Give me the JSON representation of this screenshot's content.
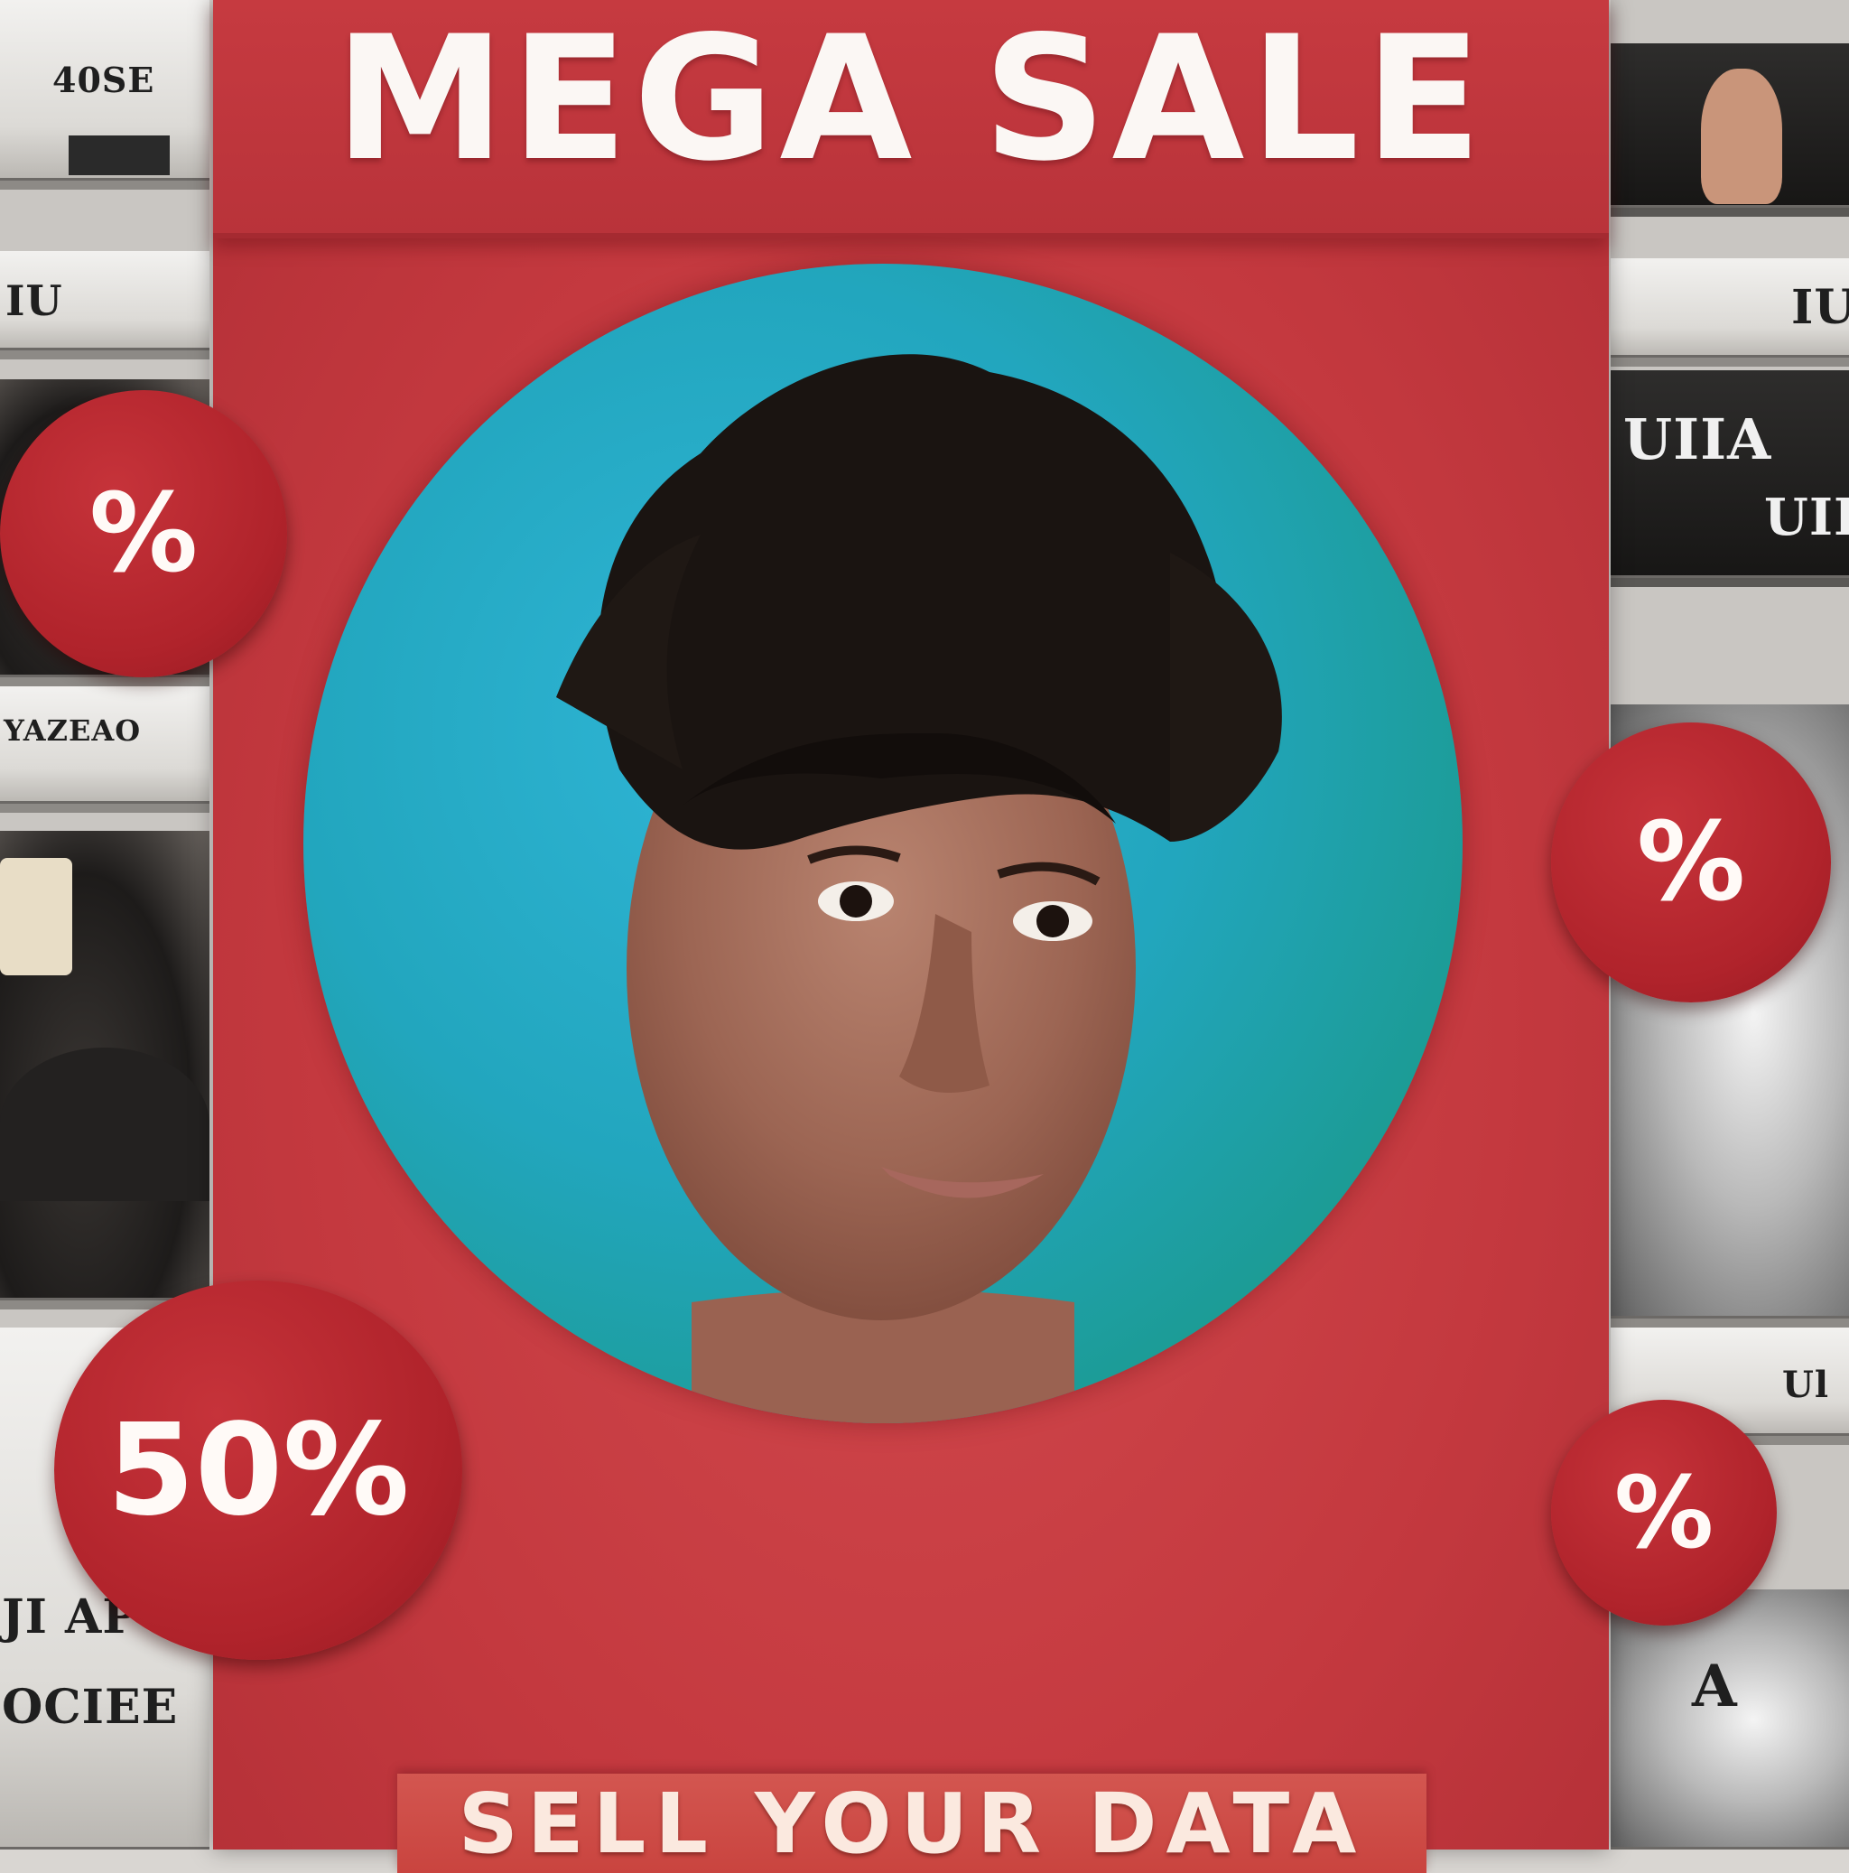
{
  "poster": {
    "headline": "MEGA SALE",
    "cta": "SELL YOUR DATA",
    "colors": {
      "poster_red": "#c4393f",
      "badge_red": "#b0232b",
      "portrait_teal": "#22a6be",
      "text_white": "#fbf7f4"
    }
  },
  "badges": [
    {
      "label": "%"
    },
    {
      "label": "50%"
    },
    {
      "label": "%"
    },
    {
      "label": "%"
    }
  ],
  "shelf_labels": {
    "left": [
      "40SE",
      "IU",
      "YAZEAO",
      "JI AP",
      "OCIEE"
    ],
    "right": [
      "IUI",
      "UIIA",
      "UIII",
      "Ul",
      "A"
    ]
  }
}
